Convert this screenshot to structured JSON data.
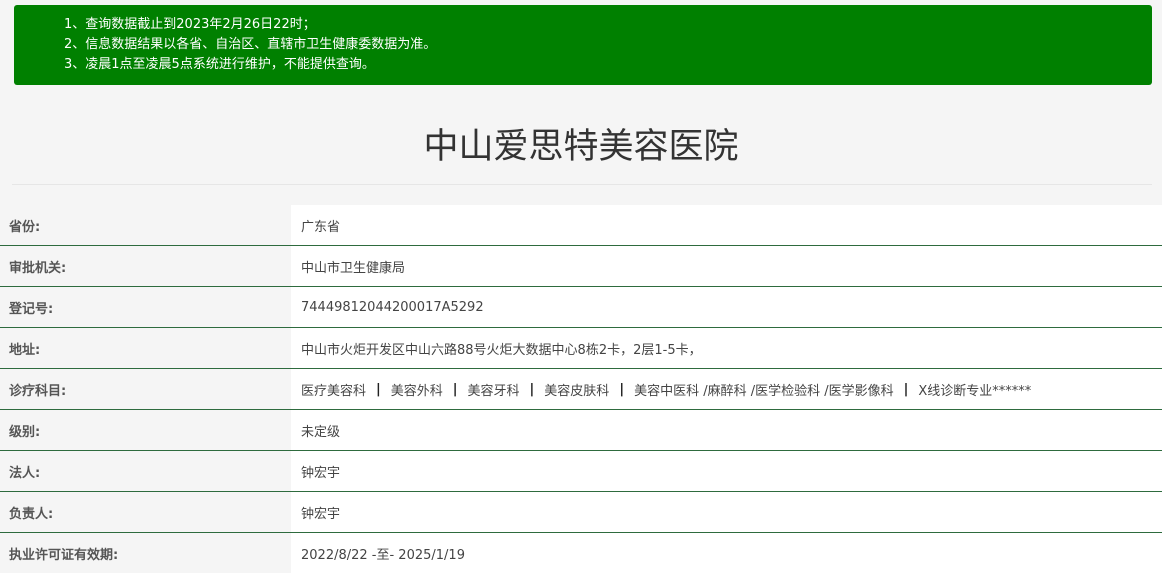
{
  "notice": {
    "lines": [
      "1、查询数据截止到2023年2月26日22时；",
      "2、信息数据结果以各省、自治区、直辖市卫生健康委数据为准。",
      "3、凌晨1点至凌晨5点系统进行维护，不能提供查询。"
    ]
  },
  "page_title": "中山爱思特美容医院",
  "details": [
    {
      "label": "省份:",
      "value": "广东省"
    },
    {
      "label": "审批机关:",
      "value": "中山市卫生健康局"
    },
    {
      "label": "登记号:",
      "value": "74449812044200017A5292"
    },
    {
      "label": "地址:",
      "value": "中山市火炬开发区中山六路88号火炬大数据中心8栋2卡，2层1-5卡，"
    },
    {
      "label": "诊疗科目:",
      "departments": [
        "医疗美容科",
        "美容外科",
        "美容牙科",
        "美容皮肤科",
        "美容中医科 /麻醉科 /医学检验科 /医学影像科",
        "X线诊断专业******"
      ],
      "separator": "|"
    },
    {
      "label": "级别:",
      "value": "未定级"
    },
    {
      "label": "法人:",
      "value": "钟宏宇"
    },
    {
      "label": "负责人:",
      "value": "钟宏宇"
    },
    {
      "label": "执业许可证有效期:",
      "value": "2022/8/22 -至- 2025/1/19"
    }
  ]
}
